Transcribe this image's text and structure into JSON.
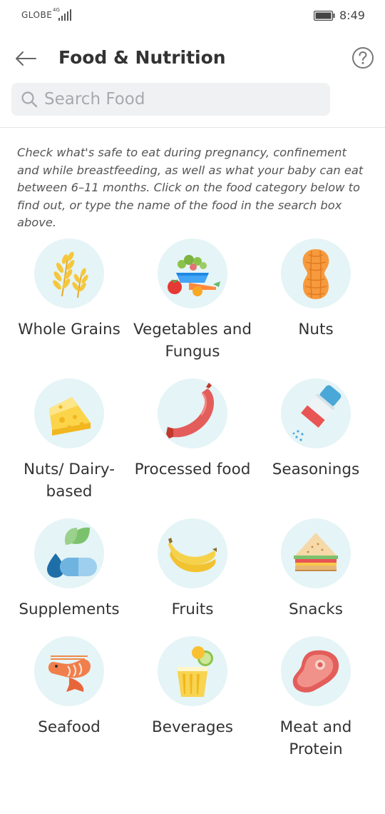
{
  "status_bar": {
    "carrier": "GLOBE",
    "network": "4G",
    "time": "8:49"
  },
  "header": {
    "title": "Food & Nutrition"
  },
  "search": {
    "placeholder": "Search Food",
    "value": ""
  },
  "intro_text": "Check what's safe to eat during pregnancy, confinement and while breastfeeding, as well as what your baby can eat between 6–11 months. Click on the food category below to find out, or type the name of the food in the search box above.",
  "categories": [
    {
      "label": "Whole Grains",
      "icon": "wheat-icon"
    },
    {
      "label": "Vegetables and Fungus",
      "icon": "vegetables-icon"
    },
    {
      "label": "Nuts",
      "icon": "peanut-icon"
    },
    {
      "label": "Nuts/ Dairy-based",
      "icon": "cheese-icon"
    },
    {
      "label": "Processed food",
      "icon": "sausage-icon"
    },
    {
      "label": "Seasonings",
      "icon": "salt-shaker-icon"
    },
    {
      "label": "Supplements",
      "icon": "supplements-icon"
    },
    {
      "label": "Fruits",
      "icon": "banana-icon"
    },
    {
      "label": "Snacks",
      "icon": "sandwich-icon"
    },
    {
      "label": "Seafood",
      "icon": "shrimp-icon"
    },
    {
      "label": "Beverages",
      "icon": "beverage-icon"
    },
    {
      "label": "Meat and Protein",
      "icon": "steak-icon"
    }
  ]
}
